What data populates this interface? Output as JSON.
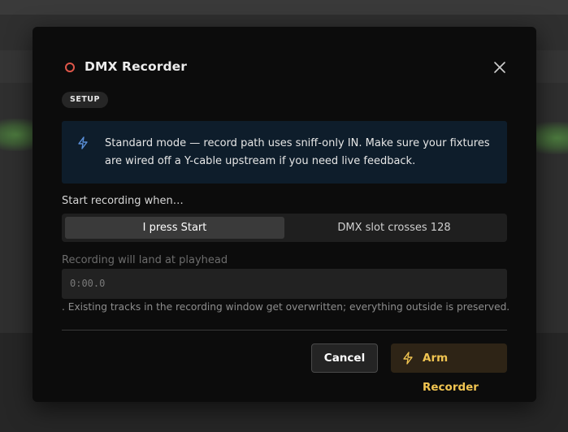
{
  "dialog": {
    "title": "DMX Recorder",
    "badge": "SETUP",
    "close_icon": "close-icon",
    "record_icon": "record-circle-icon"
  },
  "info": {
    "icon": "lightning-icon",
    "text": "Standard mode — record path uses sniff-only IN. Make sure your fixtures are wired off a Y-cable upstream if you need live feedback."
  },
  "trigger": {
    "label": "Start recording when…",
    "options": [
      "I press Start",
      "DMX slot crosses 128"
    ],
    "selected": "I press Start"
  },
  "playhead": {
    "label": "Recording will land at playhead",
    "value": "0:00.0"
  },
  "note": ". Existing tracks in the recording window get overwritten; everything outside is preserved.",
  "actions": {
    "cancel_label": "Cancel",
    "arm_label": "Arm Recorder",
    "arm_icon": "lightning-icon"
  },
  "colors": {
    "record_icon": "#e0574a",
    "info_bg": "#0e1d2b",
    "info_icon": "#5a8fd8",
    "arm_text": "#f0c451",
    "arm_bg": "#2e2416"
  }
}
